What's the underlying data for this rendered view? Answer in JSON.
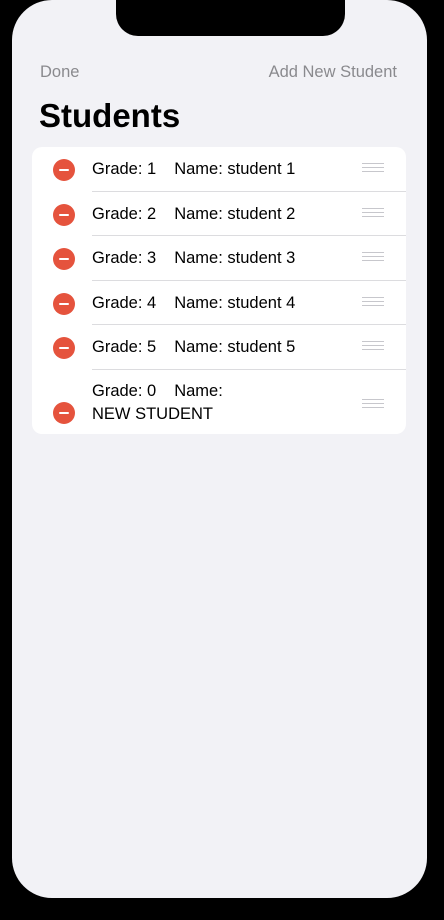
{
  "nav": {
    "left_label": "Done",
    "right_label": "Add New Student"
  },
  "page": {
    "title": "Students"
  },
  "students": [
    {
      "grade_text": "Grade: 1",
      "name_text": "Name: student 1"
    },
    {
      "grade_text": "Grade: 2",
      "name_text": "Name: student 2"
    },
    {
      "grade_text": "Grade: 3",
      "name_text": "Name: student 3"
    },
    {
      "grade_text": "Grade: 4",
      "name_text": "Name: student 4"
    },
    {
      "grade_text": "Grade: 5",
      "name_text": "Name: student 5"
    },
    {
      "grade_text": "Grade: 0",
      "name_text": "Name:",
      "name_line2": "NEW STUDENT"
    }
  ],
  "colors": {
    "background": "#f2f2f6",
    "delete_red": "#e5533d",
    "nav_gray": "#8a8a8e"
  }
}
